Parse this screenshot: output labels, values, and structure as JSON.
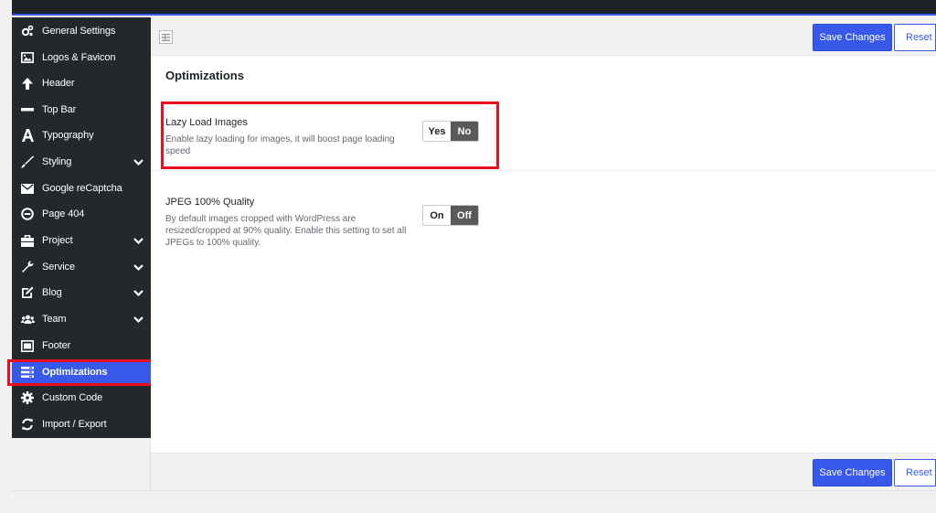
{
  "sidebar": {
    "items": [
      {
        "label": "General Settings",
        "icon": "gears-icon",
        "has_submenu": false
      },
      {
        "label": "Logos & Favicon",
        "icon": "image-icon",
        "has_submenu": false
      },
      {
        "label": "Header",
        "icon": "arrow-up-icon",
        "has_submenu": false
      },
      {
        "label": "Top Bar",
        "icon": "minus-icon",
        "has_submenu": false
      },
      {
        "label": "Typography",
        "icon": "font-icon",
        "has_submenu": false
      },
      {
        "label": "Styling",
        "icon": "brush-icon",
        "has_submenu": true
      },
      {
        "label": "Google reCaptcha",
        "icon": "envelope-icon",
        "has_submenu": false
      },
      {
        "label": "Page 404",
        "icon": "minus-circle-icon",
        "has_submenu": false
      },
      {
        "label": "Project",
        "icon": "briefcase-icon",
        "has_submenu": true
      },
      {
        "label": "Service",
        "icon": "wrench-icon",
        "has_submenu": true
      },
      {
        "label": "Blog",
        "icon": "edit-icon",
        "has_submenu": true
      },
      {
        "label": "Team",
        "icon": "users-icon",
        "has_submenu": true
      },
      {
        "label": "Footer",
        "icon": "window-icon",
        "has_submenu": false
      },
      {
        "label": "Optimizations",
        "icon": "tasks-icon",
        "has_submenu": false,
        "active": true
      },
      {
        "label": "Custom Code",
        "icon": "cog-icon",
        "has_submenu": false
      },
      {
        "label": "Import / Export",
        "icon": "refresh-icon",
        "has_submenu": false
      }
    ]
  },
  "toolbar": {
    "save_label": "Save Changes",
    "reset_label": "Reset Se"
  },
  "footer": {
    "save_label": "Save Changes",
    "reset_label": "Reset Se"
  },
  "section": {
    "title": "Optimizations"
  },
  "options": {
    "lazy_load": {
      "title": "Lazy Load Images",
      "description": "Enable lazy loading for images, it will boost page loading speed",
      "on_label": "Yes",
      "off_label": "No",
      "selected": "No"
    },
    "jpeg_quality": {
      "title": "JPEG 100% Quality",
      "description": "By default images cropped with WordPress are resized/cropped at 90% quality. Enable this setting to set all JPEGs to 100% quality.",
      "on_label": "On",
      "off_label": "Off",
      "selected": "Off"
    }
  },
  "colors": {
    "accent": "#3858e9",
    "sidebar_bg": "#23282d",
    "highlight": "#e8101e"
  }
}
